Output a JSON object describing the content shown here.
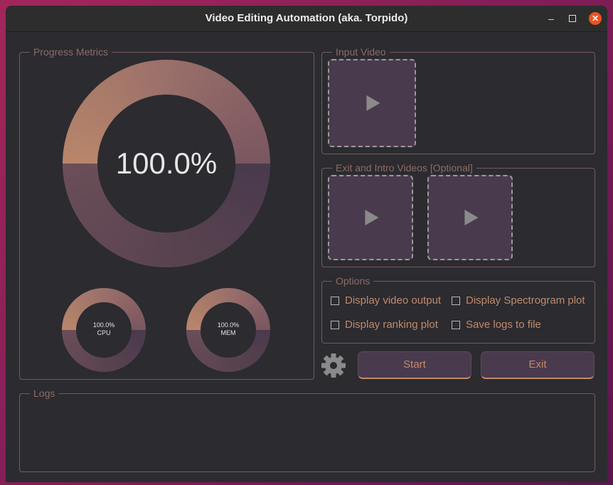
{
  "window": {
    "title": "Video Editing Automation (aka. Torpido)",
    "minimize_icon": "minimize-icon",
    "maximize_icon": "maximize-icon",
    "close_icon": "close-icon"
  },
  "progress": {
    "group_title": "Progress Metrics",
    "main": {
      "label": "100.0%",
      "value": 1.0
    },
    "cpu": {
      "value_text": "100.0%",
      "label": "CPU",
      "value": 1.0
    },
    "mem": {
      "value_text": "100.0%",
      "label": "MEM",
      "value": 1.0
    }
  },
  "input_video": {
    "group_title": "Input Video",
    "icon": "play-icon"
  },
  "extra_videos": {
    "group_title": "Exit and Intro Videos [Optional]",
    "icon": "play-icon"
  },
  "options": {
    "group_title": "Options",
    "items": [
      {
        "label": "Display video output",
        "checked": false
      },
      {
        "label": "Display Spectrogram plot",
        "checked": false
      },
      {
        "label": "Display ranking plot",
        "checked": false
      },
      {
        "label": "Save logs to file",
        "checked": false
      }
    ]
  },
  "actions": {
    "settings_icon": "gear-icon",
    "start_label": "Start",
    "exit_label": "Exit"
  },
  "logs": {
    "group_title": "Logs",
    "content": ""
  },
  "colors": {
    "accent": "#c08a6a",
    "panel": "#2b2b30",
    "track": "#4a3a4d",
    "border": "#7a5a5e",
    "close": "#e95420"
  }
}
